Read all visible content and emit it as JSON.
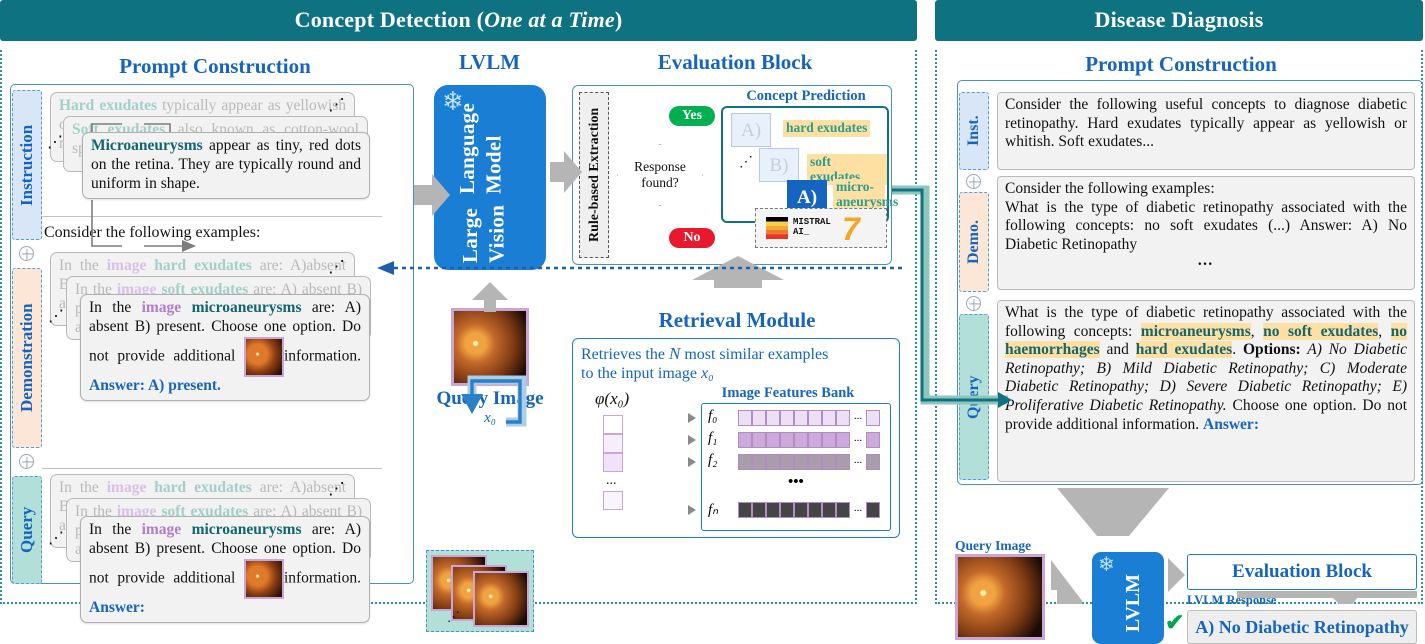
{
  "left": {
    "header": "Concept Detection (",
    "header_italic": "One at a Time",
    "header_tail": ")",
    "prompt_construction_title": "Prompt Construction",
    "lvlm_title": "LVLM",
    "evaluation_title": "Evaluation Block",
    "retrieval_title": "Retrieval Module",
    "tabs": {
      "instruction": "Instruction",
      "demonstration": "Demonstration",
      "query": "Query"
    },
    "instruction_cards": {
      "back": {
        "lead": "Hard exudates",
        "rest": " typically appear as yellowish or whitish, well-defined spots with sharp margins."
      },
      "mid": {
        "lead": "Soft exudates",
        "rest": ", also known as cotton-wool spots, are pale, fluffy, cloud-like."
      },
      "front": {
        "lead": "Microaneurysms",
        "rest": " appear as tiny, red dots on the retina. They are typically round and uniform in shape."
      }
    },
    "demo_intro": "Consider the following examples:",
    "demo_cards": {
      "back": {
        "p1": "In the ",
        "k1": "image",
        "k2": "hard exudates",
        "p2": " are: A)absent B)present. Choose one option. Do not provide additional information."
      },
      "mid": {
        "p1": "In the ",
        "k1": "image",
        "k2": "soft exudates",
        "p2": " are: A) absent B) present. Choose one option. Do not provide additional information."
      },
      "front": {
        "p1": "In the ",
        "k1": "image",
        "k2": "microaneurysms",
        "p2": " are: A) absent B) present. Choose one option. Do not provide additional ",
        "p3": "information. ",
        "answer": "Answer: A) present."
      }
    },
    "query_cards": {
      "front": {
        "p1": "In the ",
        "k1": "image",
        "k2": "microaneurysms",
        "p2": " are: A) absent B) present. Choose one option. Do not provide additional ",
        "p3": "information. ",
        "answer": "Answer:"
      }
    },
    "lvlm_label": "Large Vision\nLanguage Model",
    "lvlm_line1": "Large Vision",
    "lvlm_line2": "Language Model",
    "rule_based": "Rule-based Extraction",
    "response_found": "Response found?",
    "yes": "Yes",
    "no": "No",
    "concept_prediction": "Concept Prediction",
    "concept_options": [
      {
        "letter": "A)",
        "tag": "hard exudates",
        "selected": false
      },
      {
        "letter": "B)",
        "tag": "soft exudates",
        "selected": false
      },
      {
        "letter": "A)",
        "tag": "micro-aneurysms",
        "selected": true
      }
    ],
    "mistral": {
      "word1": "MISTRAL",
      "word2": "AI_",
      "seven": "7"
    },
    "query_image_caption": "Query Image",
    "query_image_sub": "x₀",
    "retrieval_desc_1": "Retrieves the ",
    "retrieval_desc_N": "N",
    "retrieval_desc_2": " most similar examples",
    "retrieval_desc_3": "to the input image ",
    "retrieval_desc_x0": "x₀",
    "image_features_bank": "Image Features Bank",
    "phi": "φ(x₀)",
    "feature_rows": [
      "f₀",
      "f₁",
      "f₂",
      "fₙ"
    ],
    "row_dots": "•••",
    "ellipsis": "⋯"
  },
  "right": {
    "header": "Disease Diagnosis",
    "prompt_construction_title": "Prompt Construction",
    "tabs": {
      "instruction": "Inst.",
      "demonstration": "Demo.",
      "query": "Query"
    },
    "instruction_text": "Consider the following useful concepts to diagnose diabetic retinopathy. Hard exudates typically appear as yellowish or whitish. Soft exudates...",
    "demo_line1": "Consider the following examples:",
    "demo_line2": "What is the type of diabetic retinopathy associated with the following concepts: no soft exudates (...) Answer: A) No Diabetic Retinopathy",
    "demo_dots": "…",
    "query": {
      "lead": "What is the type of diabetic retinopathy associated with the following concepts: ",
      "c1": "microaneurysms",
      "c2": "no soft exudates",
      "c3": "no haemorrhages",
      "c4": "hard exudates",
      "sep1": ", ",
      "sep2": ", ",
      "sep3": " and ",
      "period": ".",
      "options_label": "Options:",
      "options_text": " A) No Diabetic Retinopathy; B) Mild Diabetic Retinopathy; C) Moderate Diabetic Retinopathy; D) Severe Diabetic Retinopathy; E) Proliferative Diabetic Retinopathy.",
      "tail": " Choose one option. Do not provide additional information. ",
      "answer": "Answer:"
    },
    "query_image_caption": "Query Image",
    "lvlm_label": "LVLM",
    "evaluation_title": "Evaluation Block",
    "response_label": "LVLM Response",
    "response_value": "A) No Diabetic Retinopathy",
    "check": "✔"
  },
  "colors": {
    "header_teal": "#0e7280",
    "title_blue": "#1565c0",
    "lvlm_blue": "#1a7fd4",
    "concept_teal": "#2a9d8f",
    "highlight_yellow": "#ffe0a3",
    "tab_inst": "#d9e6f7",
    "tab_demo": "#fce6d5",
    "tab_query": "#b2e0d8",
    "yes_green": "#00b050",
    "no_red": "#e8192c"
  }
}
